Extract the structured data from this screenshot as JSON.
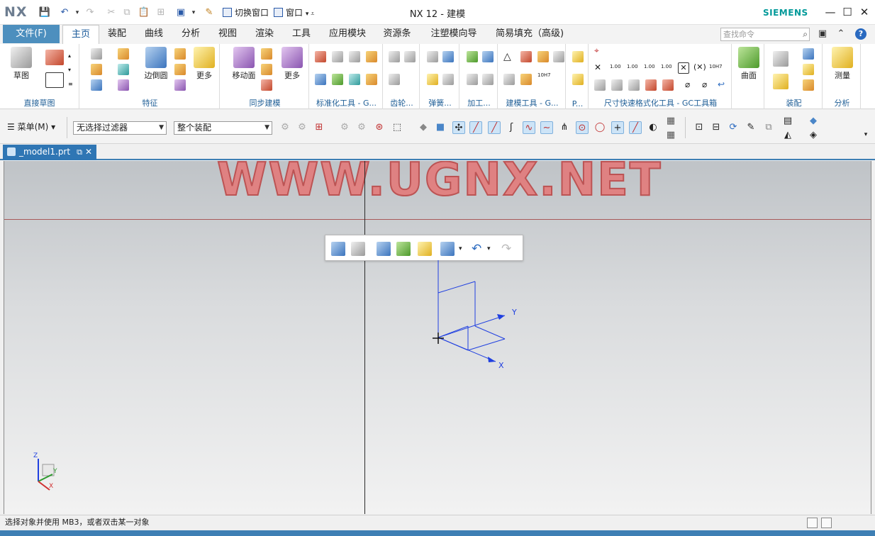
{
  "titlebar": {
    "logo": "NX",
    "switch_window": "切换窗口",
    "window": "窗口",
    "title": "NX 12 - 建模",
    "brand": "SIEMENS",
    "minimize": "—",
    "maximize": "☐",
    "close": "✕"
  },
  "tabs": {
    "file": "文件(F)",
    "items": [
      "主页",
      "装配",
      "曲线",
      "分析",
      "视图",
      "渲染",
      "工具",
      "应用模块",
      "资源条",
      "注塑模向导",
      "简易填充（高级)"
    ],
    "search_placeholder": "查找命令"
  },
  "ribbon": {
    "sketch": "草图",
    "direct_sketch": "直接草图",
    "edge_blend": "边倒圆",
    "more": "更多",
    "feature": "特征",
    "move_face": "移动面",
    "sync_modeling": "同步建模",
    "std_tools": "标准化工具 - G...",
    "gear": "齿轮...",
    "spring": "弹簧...",
    "machining": "加工...",
    "build_tools": "建模工具 - G...",
    "p_short": "P...",
    "dim_format": "尺寸快速格式化工具 - GC工具箱",
    "surface": "曲面",
    "assembly": "装配",
    "measure": "测量",
    "analysis": "分析",
    "tol_labels": [
      "1.00",
      "1.00",
      "1.00",
      "1.00"
    ],
    "h7": "10H7"
  },
  "toolbar2": {
    "menu": "菜单(M)",
    "filter": "无选择过滤器",
    "assembly_scope": "整个装配"
  },
  "document": {
    "tab_name": "_model1.prt"
  },
  "viewport": {
    "watermark": "WWW.UGNX.NET",
    "axis_x": "X",
    "axis_y": "Y",
    "axis_z": "Z"
  },
  "status": {
    "message": "选择对象并使用 MB3，或者双击某一对象"
  }
}
